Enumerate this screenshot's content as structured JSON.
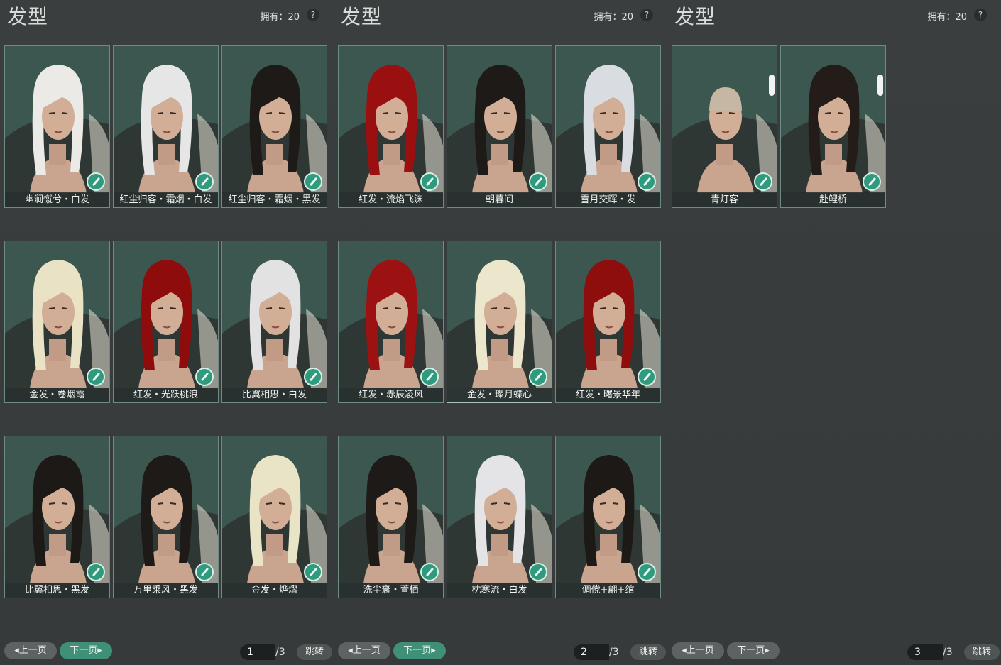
{
  "panels": [
    {
      "title": "发型",
      "owned": "拥有：20",
      "help": "?",
      "items": [
        {
          "label": "幽涧憱兮・白发",
          "hair": "#eceae6",
          "selected": false
        },
        {
          "label": "红尘归客・霜烟・白发",
          "hair": "#e6e6e6",
          "selected": false
        },
        {
          "label": "红尘归客・霜烟・黑发",
          "hair": "#1d1a18",
          "selected": false
        },
        {
          "label": "金发・卷烟霞",
          "hair": "#e9e2c4",
          "selected": false
        },
        {
          "label": "红发・光跃桃浪",
          "hair": "#8f0c0c",
          "selected": false
        },
        {
          "label": "比翼相思・白发",
          "hair": "#e2e2e2",
          "selected": false
        },
        {
          "label": "比翼相思・黑发",
          "hair": "#1c1917",
          "selected": false
        },
        {
          "label": "万里乘风・黑发",
          "hair": "#1e1a17",
          "selected": false
        },
        {
          "label": "金发・烨熠",
          "hair": "#eae4c6",
          "selected": false
        }
      ],
      "pager": {
        "prev": "上一页",
        "next": "下一页",
        "page": "1",
        "total": "/3",
        "jump": "跳转",
        "next_active": true
      }
    },
    {
      "title": "发型",
      "owned": "拥有：20",
      "help": "?",
      "items": [
        {
          "label": "红发・流焰飞渊",
          "hair": "#9a0f0f",
          "selected": false
        },
        {
          "label": "朝暮间",
          "hair": "#1d1a18",
          "selected": false
        },
        {
          "label": "雪月交晖・发",
          "hair": "#d9dde2",
          "selected": false
        },
        {
          "label": "红发・赤辰凌风",
          "hair": "#9c1212",
          "selected": false
        },
        {
          "label": "金发・璨月蝶心",
          "hair": "#ece6cc",
          "selected": true
        },
        {
          "label": "红发・曙景华年",
          "hair": "#8e0d0d",
          "selected": false
        },
        {
          "label": "洗尘寰・萱栖",
          "hair": "#1d1a18",
          "selected": false
        },
        {
          "label": "枕寒流・白发",
          "hair": "#e4e4e6",
          "selected": false
        },
        {
          "label": "倜傥+翩+绾",
          "hair": "#1c1917",
          "selected": false
        }
      ],
      "pager": {
        "prev": "上一页",
        "next": "下一页",
        "page": "2",
        "total": "/3",
        "jump": "跳转",
        "next_active": true
      }
    },
    {
      "title": "发型",
      "owned": "拥有：20",
      "help": "?",
      "items": [
        {
          "label": "青灯客",
          "hair": "#c6b6a4",
          "selected": false,
          "bald": true,
          "badge": true
        },
        {
          "label": "赴鲤桥",
          "hair": "#231c18",
          "selected": false,
          "badge": true
        }
      ],
      "pager": {
        "prev": "上一页",
        "next": "下一页",
        "page": "3",
        "total": "/3",
        "jump": "跳转",
        "next_active": false
      }
    }
  ],
  "colors": {
    "accent": "#3f8f79",
    "card_border": "#6d8c83",
    "card_bg": "#3f5a52"
  },
  "icons": {
    "dye": "brush-dye-icon",
    "help": "question-icon"
  }
}
